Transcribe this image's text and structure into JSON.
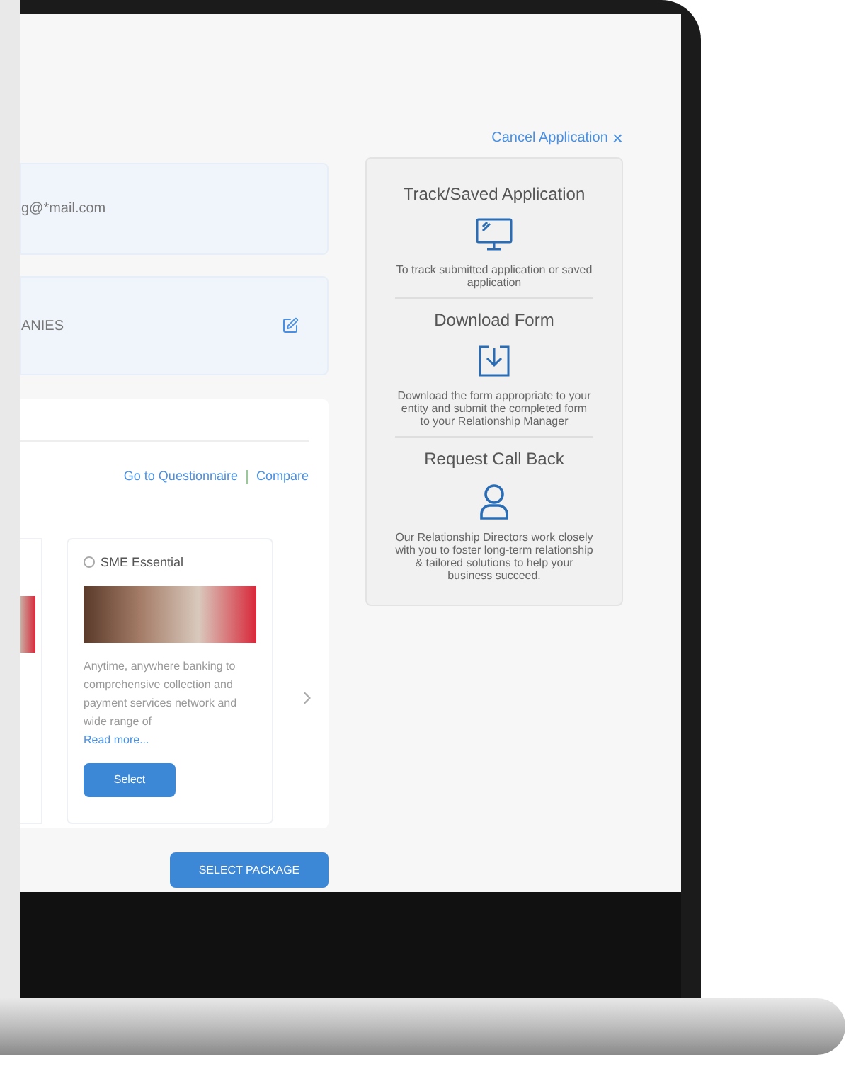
{
  "cancel_link": {
    "label": "Cancel Application",
    "icon": "×"
  },
  "fields": [
    {
      "value": "g@*mail.com",
      "editable": false
    },
    {
      "value": "ANIES",
      "editable": true
    }
  ],
  "packages_section": {
    "links": [
      "Go to Questionnaire",
      "Compare"
    ],
    "cards": [
      {
        "kind": "partial"
      },
      {
        "kind": "full",
        "title": "SME Essential",
        "selected": false,
        "description": "Anytime, anywhere banking to comprehensive collection and payment services network and wide range of",
        "read_more": "Read more...",
        "button": "Select"
      }
    ]
  },
  "primary_button": "SELECT PACKAGE",
  "side_panel": [
    {
      "kind": "monitor",
      "title": "Track/Saved Application",
      "text": "To track submitted application or saved application"
    },
    {
      "kind": "download",
      "title": "Download Form",
      "text": "Download the form appropriate to your entity and submit the completed form to your Relationship Manager"
    },
    {
      "kind": "person",
      "title": "Request Call Back",
      "text": "Our Relationship Directors work closely with you to foster long-term relationship & tailored solutions to help your business succeed."
    }
  ]
}
